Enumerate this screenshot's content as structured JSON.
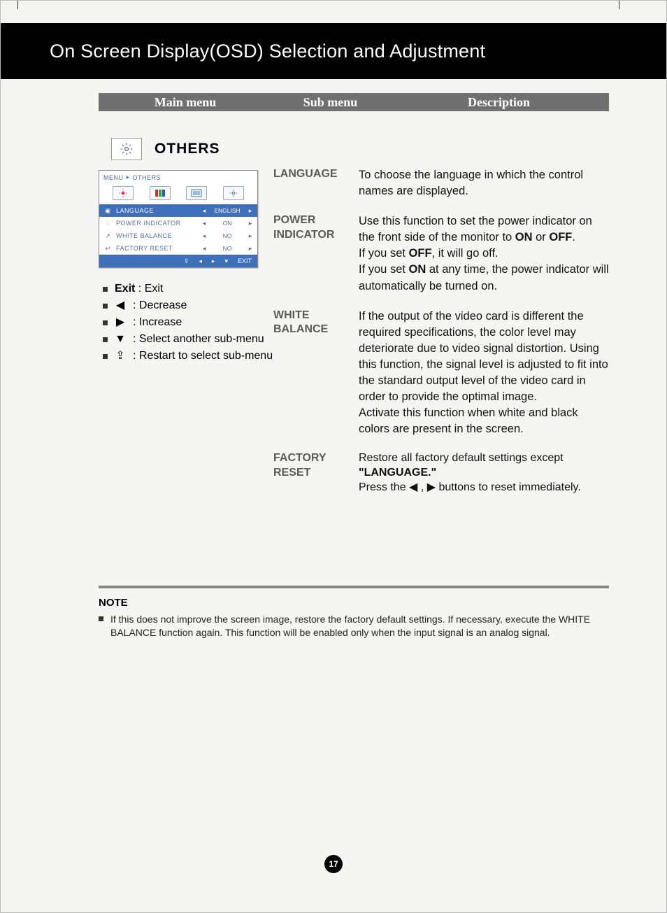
{
  "page_title": "On Screen Display(OSD) Selection and Adjustment",
  "columns": {
    "main": "Main menu",
    "sub": "Sub menu",
    "desc": "Description"
  },
  "section_label": "OTHERS",
  "osd": {
    "breadcrumb_prefix": "MENU",
    "breadcrumb_current": "OTHERS",
    "rows": [
      {
        "icon": "globe",
        "label": "LANGUAGE",
        "value": "ENGLISH",
        "selected": true
      },
      {
        "icon": "lamp",
        "label": "POWER INDICATOR",
        "value": "ON",
        "selected": false
      },
      {
        "icon": "curve",
        "label": "WHITE BALANCE",
        "value": "NO",
        "selected": false
      },
      {
        "icon": "return",
        "label": "FACTORY RESET",
        "value": "NO",
        "selected": false
      }
    ],
    "nav_exit": "EXIT"
  },
  "legend": {
    "l0_key": "Exit",
    "l0_val": ": Exit",
    "l1": ": Decrease",
    "l2": ": Increase",
    "l3": ": Select another sub-menu",
    "l4": ": Restart to select sub-menu"
  },
  "items": {
    "language": {
      "sub": "LANGUAGE",
      "desc": "To choose the language in which the control names are displayed."
    },
    "power": {
      "sub": "POWER INDICATOR",
      "desc_pre": "Use this function to set the power indicator on the front side of the monitor to ",
      "on": "ON",
      "or": " or ",
      "off": "OFF",
      "period": ".",
      "line2a": "If you set ",
      "line2b": "OFF",
      "line2c": ", it will go off.",
      "line3a": "If you set ",
      "line3b": "ON",
      "line3c": " at any time, the power indicator will automatically be turned on."
    },
    "white": {
      "sub": "WHITE BALANCE",
      "desc1": "If the output of the video card is different the required specifications, the color level may deteriorate due to video signal distortion. Using this function, the signal level is adjusted to fit into the standard output level of the video card in order to provide the optimal image.",
      "desc2": "Activate this function when white and black colors are present in the screen."
    },
    "factory": {
      "sub": "FACTORY RESET",
      "d1": "Restore all factory default settings except ",
      "d2": "\"LANGUAGE.\"",
      "d3a": "Press the ",
      "d3b": " , ",
      "d3c": "  buttons to reset immediately."
    }
  },
  "note": {
    "title": "NOTE",
    "body": "If this does not improve the screen image, restore the factory default settings. If necessary, execute the WHITE BALANCE function again. This function will be enabled only when the input signal is an analog signal."
  },
  "page_number": "17"
}
